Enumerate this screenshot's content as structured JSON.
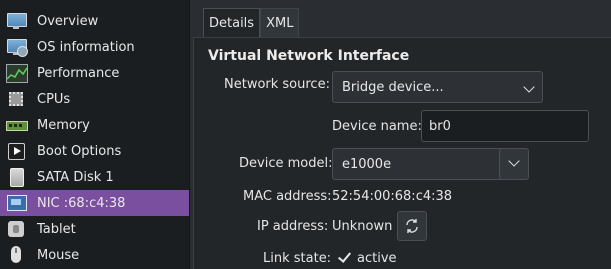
{
  "sidebar": {
    "items": [
      {
        "label": "Overview",
        "icon": "monitor-icon"
      },
      {
        "label": "OS information",
        "icon": "os-info-icon"
      },
      {
        "label": "Performance",
        "icon": "performance-graph-icon"
      },
      {
        "label": "CPUs",
        "icon": "cpu-chip-icon"
      },
      {
        "label": "Memory",
        "icon": "memory-ram-icon"
      },
      {
        "label": "Boot Options",
        "icon": "boot-icon"
      },
      {
        "label": "SATA Disk 1",
        "icon": "disk-icon"
      },
      {
        "label": "NIC :68:c4:38",
        "icon": "network-card-icon",
        "selected": true
      },
      {
        "label": "Tablet",
        "icon": "tablet-icon"
      },
      {
        "label": "Mouse",
        "icon": "mouse-icon"
      }
    ]
  },
  "tabs": [
    {
      "label": "Details",
      "active": true
    },
    {
      "label": "XML",
      "active": false
    }
  ],
  "section": {
    "title": "Virtual Network Interface"
  },
  "form": {
    "network_source": {
      "label": "Network source:",
      "value": "Bridge device..."
    },
    "device_name": {
      "label": "Device name:",
      "value": "br0"
    },
    "device_model": {
      "label": "Device model:",
      "value": "e1000e"
    },
    "mac_address": {
      "label": "MAC address:",
      "value": "52:54:00:68:c4:38"
    },
    "ip_address": {
      "label": "IP address:",
      "value": "Unknown"
    },
    "link_state": {
      "label": "Link state:",
      "value": "active",
      "checked": true
    }
  },
  "colors": {
    "selection": "#7a4f9f",
    "sidebar_bg": "#1b1e20",
    "panel_bg": "#232629"
  }
}
